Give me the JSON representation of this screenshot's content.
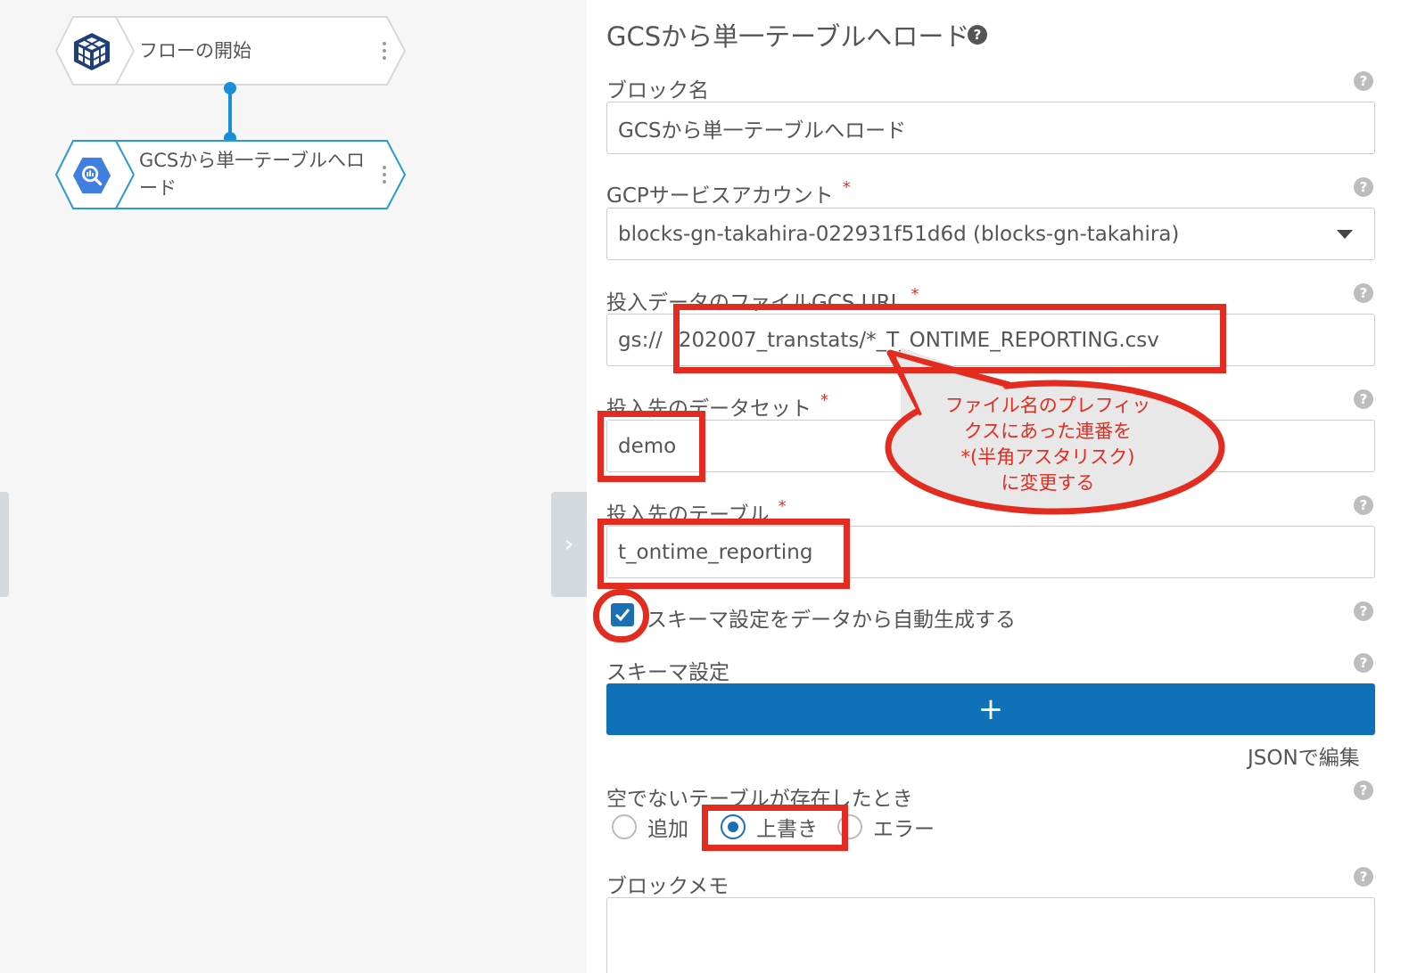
{
  "canvas": {
    "nodes": [
      {
        "label": "フローの開始",
        "icon": "cube-logo-icon"
      },
      {
        "label": "GCSから単一テーブルへロード",
        "icon": "bigquery-icon"
      }
    ],
    "toggle_glyph": "›"
  },
  "panel": {
    "title": "GCSから単一テーブルへロード",
    "help_glyph": "?",
    "fields": {
      "block_name": {
        "label": "ブロック名",
        "value": "GCSから単一テーブルへロード"
      },
      "service_account": {
        "label": "GCPサービスアカウント",
        "required": "*",
        "value": "blocks-gn-takahira-022931f51d6d (blocks-gn-takahira)"
      },
      "gcs_url": {
        "label": "投入データのファイルGCS URL",
        "required": "*",
        "prefix": "gs://",
        "value": "202007_transtats/*_T_ONTIME_REPORTING.csv"
      },
      "dataset": {
        "label": "投入先のデータセット",
        "required": "*",
        "value": "demo"
      },
      "table": {
        "label": "投入先のテーブル",
        "required": "*",
        "value": "t_ontime_reporting"
      },
      "auto_schema": {
        "label": "スキーマ設定をデータから自動生成する",
        "checked": true
      },
      "schema": {
        "label": "スキーマ設定",
        "add_glyph": "+",
        "json_link": "JSONで編集"
      },
      "if_exists": {
        "label": "空でないテーブルが存在したとき",
        "options": [
          "追加",
          "上書き",
          "エラー"
        ],
        "selected": "上書き"
      },
      "memo": {
        "label": "ブロックメモ",
        "value": ""
      }
    }
  },
  "annotation": {
    "lines": [
      "ファイル名のプレフィッ",
      "クスにあった連番を",
      "*(半角アスタリスク)",
      "に変更する"
    ],
    "color": "#e32b1f"
  },
  "colors": {
    "accent": "#0f72b8",
    "connector": "#1a8fd8",
    "annotation": "#e32b1f"
  }
}
